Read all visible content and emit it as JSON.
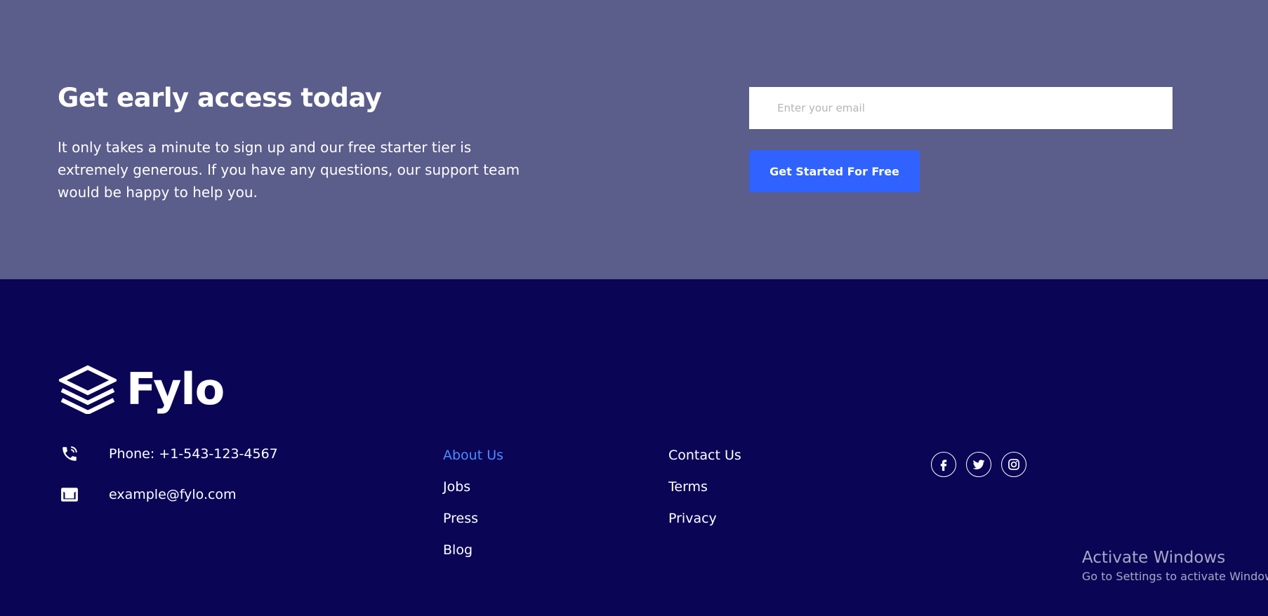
{
  "cta": {
    "title": "Get early access today",
    "description": "It only takes a minute to sign up and our free starter tier is extremely generous. If you have any questions, our support team would be happy to help you.",
    "email_placeholder": "Enter your email",
    "button_label": "Get Started For Free",
    "background_color": "#5b5d8a",
    "button_color": "#3062ff"
  },
  "footer": {
    "background_color": "#0b0556",
    "logo": {
      "text": "Fylo",
      "icon": "stacked-layers-icon"
    },
    "contact": {
      "phone": {
        "icon": "phone-icon",
        "text": "Phone: +1-543-123-4567"
      },
      "email": {
        "icon": "mail-icon",
        "text": "example@fylo.com"
      }
    },
    "links_col1": [
      "About Us",
      "Jobs",
      "Press",
      "Blog"
    ],
    "links_col2": [
      "Contact Us",
      "Terms",
      "Privacy"
    ],
    "active_link_color": "#4b8dff",
    "social": [
      "facebook-icon",
      "twitter-icon",
      "instagram-icon"
    ]
  },
  "watermark": {
    "title": "Activate Windows",
    "subtitle": "Go to Settings to activate Windows."
  }
}
